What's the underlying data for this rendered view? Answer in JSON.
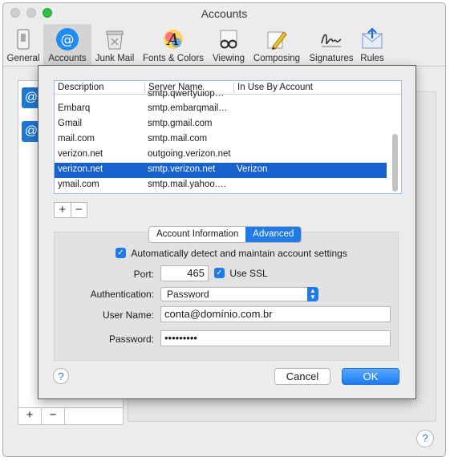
{
  "window": {
    "title": "Accounts"
  },
  "toolbar": {
    "items": [
      {
        "label": "General",
        "icon": "general-icon"
      },
      {
        "label": "Accounts",
        "icon": "at-sign-icon",
        "selected": true
      },
      {
        "label": "Junk Mail",
        "icon": "junk-mail-icon"
      },
      {
        "label": "Fonts & Colors",
        "icon": "fonts-colors-icon"
      },
      {
        "label": "Viewing",
        "icon": "glasses-icon"
      },
      {
        "label": "Composing",
        "icon": "pencil-icon"
      },
      {
        "label": "Signatures",
        "icon": "signature-icon"
      },
      {
        "label": "Rules",
        "icon": "rules-icon"
      }
    ]
  },
  "background": {
    "account_icon": "@",
    "plus": "+",
    "minus": "−",
    "help": "?"
  },
  "smtp_table": {
    "columns": [
      "Description",
      "Server Name",
      "In Use By Account"
    ],
    "rows": [
      {
        "description": "",
        "server": "smtp.qwertyuiop…",
        "in_use": ""
      },
      {
        "description": "Embarq",
        "server": "smtp.embarqmail…",
        "in_use": ""
      },
      {
        "description": "Gmail",
        "server": "smtp.gmail.com",
        "in_use": ""
      },
      {
        "description": "mail.com",
        "server": "smtp.mail.com",
        "in_use": ""
      },
      {
        "description": "verizon.net",
        "server": "outgoing.verizon.net",
        "in_use": ""
      },
      {
        "description": "verizon.net",
        "server": "smtp.verizon.net",
        "in_use": "Verizon",
        "selected": true
      },
      {
        "description": "ymail.com",
        "server": "smtp.mail.yahoo.…",
        "in_use": ""
      }
    ],
    "add_label": "+",
    "remove_label": "−"
  },
  "tabs": {
    "account_information": "Account Information",
    "advanced": "Advanced",
    "selected": "Advanced"
  },
  "advanced": {
    "auto_detect_label": "Automatically detect and maintain account settings",
    "auto_detect_checked": true,
    "port_label": "Port:",
    "port_value": "465",
    "use_ssl_label": "Use SSL",
    "use_ssl_checked": true,
    "authentication_label": "Authentication:",
    "authentication_value": "Password",
    "username_label": "User Name:",
    "username_value": "conta@domínio.com.br",
    "password_label": "Password:",
    "password_value": "•••••••••"
  },
  "buttons": {
    "help": "?",
    "cancel": "Cancel",
    "ok": "OK"
  },
  "colors": {
    "accent": "#1e7ae6",
    "selection": "#1862d0",
    "traffic_green": "#2ec242"
  }
}
